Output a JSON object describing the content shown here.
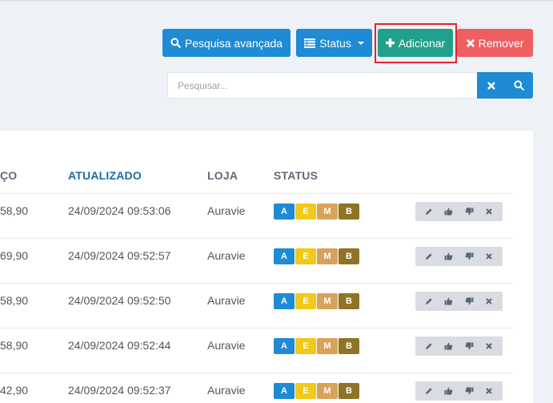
{
  "toolbar": {
    "advanced_search_label": "Pesquisa avançada",
    "status_label": "Status",
    "add_label": "Adicionar",
    "remove_label": "Remover"
  },
  "search": {
    "placeholder": "Pesquisar...",
    "value": ""
  },
  "colors": {
    "primary": "#1e8bd4",
    "success": "#21a08c",
    "danger": "#ee5f62",
    "highlight": "#e0252f"
  },
  "table": {
    "columns": {
      "price_partial": "ÇO",
      "updated": "ATUALIZADO",
      "store": "LOJA",
      "status": "STATUS"
    },
    "status_badges": [
      {
        "label": "A",
        "color": "#1e8bd4"
      },
      {
        "label": "E",
        "color": "#f2c81a"
      },
      {
        "label": "M",
        "color": "#d9a25b"
      },
      {
        "label": "B",
        "color": "#8e7424"
      }
    ],
    "row_actions": [
      "pencil-icon",
      "thumbs-up-icon",
      "thumbs-down-icon",
      "close-icon"
    ],
    "rows": [
      {
        "price": "58,90",
        "updated": "24/09/2024 09:53:06",
        "store": "Auravie"
      },
      {
        "price": "69,90",
        "updated": "24/09/2024 09:52:57",
        "store": "Auravie"
      },
      {
        "price": "58,90",
        "updated": "24/09/2024 09:52:50",
        "store": "Auravie"
      },
      {
        "price": "58,90",
        "updated": "24/09/2024 09:52:44",
        "store": "Auravie"
      },
      {
        "price": "42,90",
        "updated": "24/09/2024 09:52:37",
        "store": "Auravie"
      }
    ]
  }
}
